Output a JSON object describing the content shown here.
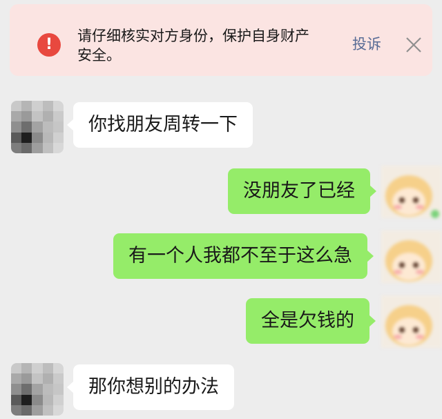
{
  "banner": {
    "text": "请仔细核实对方身份，保护自身财产安全。",
    "report_label": "投诉",
    "icon": "exclamation-circle-icon",
    "close_icon": "close-icon",
    "warning_color": "#e8483f",
    "link_color": "#576b95"
  },
  "messages": [
    {
      "side": "incoming",
      "text": "你找朋友周转一下"
    },
    {
      "side": "outgoing",
      "text": "没朋友了已经"
    },
    {
      "side": "outgoing",
      "text": "有一个人我都不至于这么急"
    },
    {
      "side": "outgoing",
      "text": "全是欠钱的"
    },
    {
      "side": "incoming",
      "text": "那你想别的办法"
    }
  ],
  "colors": {
    "outgoing_bubble": "#95ec69",
    "incoming_bubble": "#ffffff",
    "background": "#ededed"
  }
}
